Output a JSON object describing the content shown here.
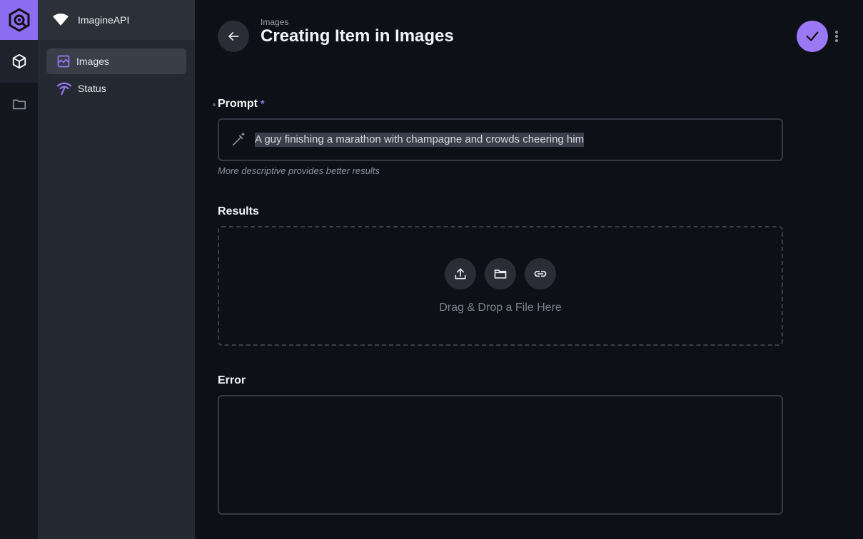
{
  "app": {
    "project_name": "ImagineAPI"
  },
  "modules": [
    {
      "name": "content",
      "icon": "box-icon",
      "active": true
    },
    {
      "name": "files",
      "icon": "folder-icon",
      "active": false
    }
  ],
  "nav": {
    "items": [
      {
        "label": "Images",
        "icon": "image-icon",
        "active": true
      },
      {
        "label": "Status",
        "icon": "signal-icon",
        "active": false
      }
    ]
  },
  "header": {
    "breadcrumb": "Images",
    "title": "Creating Item in Images"
  },
  "form": {
    "prompt": {
      "label": "Prompt",
      "required_marker": "*",
      "value": "A guy finishing a marathon with champagne and crowds cheering him",
      "hint": "More descriptive provides better results"
    },
    "results": {
      "label": "Results",
      "dropzone_text": "Drag & Drop a File Here"
    },
    "error": {
      "label": "Error",
      "value": ""
    }
  },
  "colors": {
    "accent": "#9a78f6",
    "logo_tile": "#8c6cf2",
    "background": "#0e1017",
    "sidebar": "#252932"
  }
}
